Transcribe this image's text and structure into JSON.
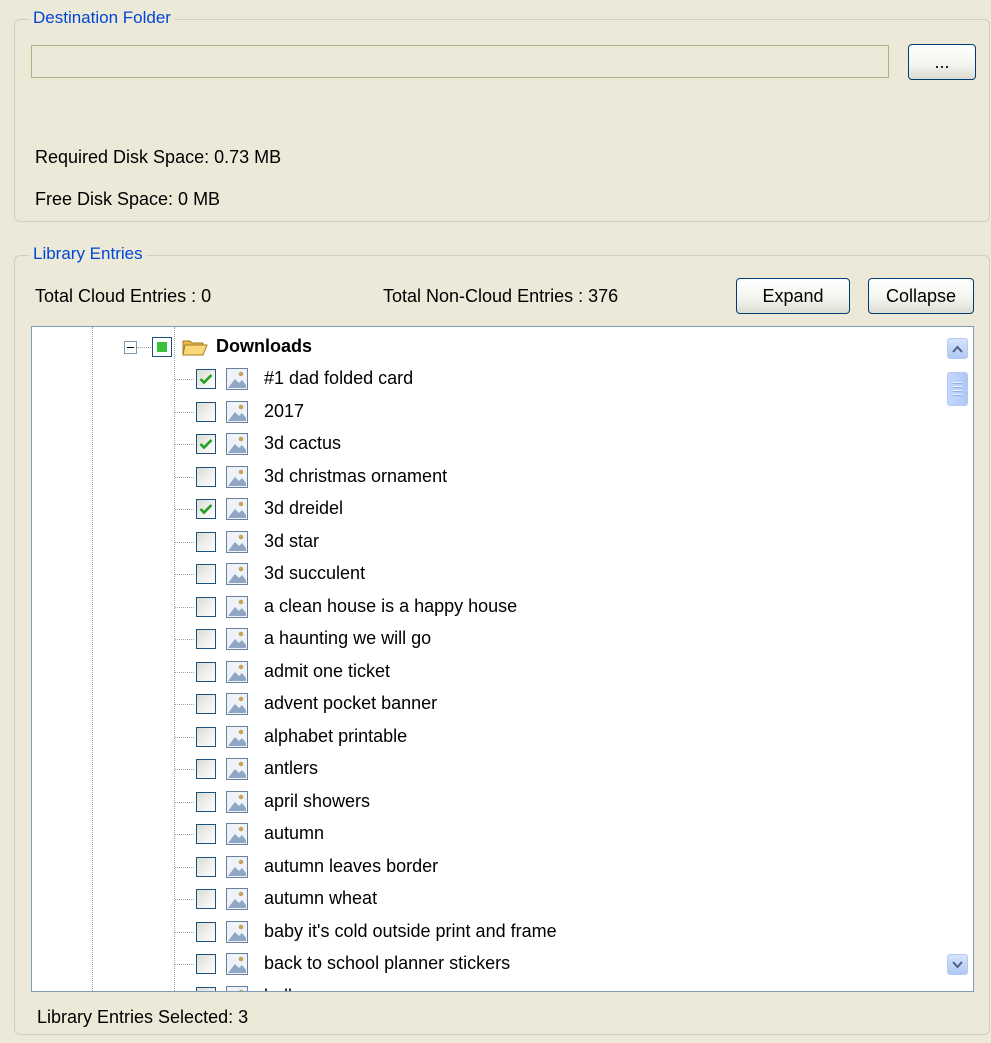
{
  "destination": {
    "group_title": "Destination Folder",
    "path_value": "",
    "browse_label": "...",
    "required_disk_space": "Required Disk Space: 0.73 MB",
    "free_disk_space": "Free Disk Space: 0 MB"
  },
  "library": {
    "group_title": "Library Entries",
    "total_cloud": "Total Cloud Entries : 0",
    "total_non_cloud": "Total Non-Cloud Entries : 376",
    "expand_label": "Expand",
    "collapse_label": "Collapse",
    "selected_text": "Library Entries Selected: 3"
  },
  "tree": {
    "root": {
      "label": "Downloads",
      "state": "partial",
      "icon": "folder-icon"
    },
    "items": [
      {
        "label": "#1 dad folded card",
        "checked": true
      },
      {
        "label": "2017",
        "checked": false
      },
      {
        "label": "3d cactus",
        "checked": true
      },
      {
        "label": "3d christmas ornament",
        "checked": false
      },
      {
        "label": "3d dreidel",
        "checked": true
      },
      {
        "label": "3d star",
        "checked": false
      },
      {
        "label": "3d succulent",
        "checked": false
      },
      {
        "label": "a clean house is a happy house",
        "checked": false
      },
      {
        "label": "a haunting we will go",
        "checked": false
      },
      {
        "label": "admit one ticket",
        "checked": false
      },
      {
        "label": "advent pocket banner",
        "checked": false
      },
      {
        "label": "alphabet printable",
        "checked": false
      },
      {
        "label": "antlers",
        "checked": false
      },
      {
        "label": "april showers",
        "checked": false
      },
      {
        "label": "autumn",
        "checked": false
      },
      {
        "label": "autumn leaves border",
        "checked": false
      },
      {
        "label": "autumn wheat",
        "checked": false
      },
      {
        "label": "baby it's cold outside print and frame",
        "checked": false
      },
      {
        "label": "back to school planner stickers",
        "checked": false
      },
      {
        "label": "balloons",
        "checked": false
      }
    ]
  },
  "colors": {
    "window_bg": "#ece9d8",
    "group_title": "#0046d5",
    "check_green": "#21a121",
    "partial_green": "#3bc23b"
  }
}
